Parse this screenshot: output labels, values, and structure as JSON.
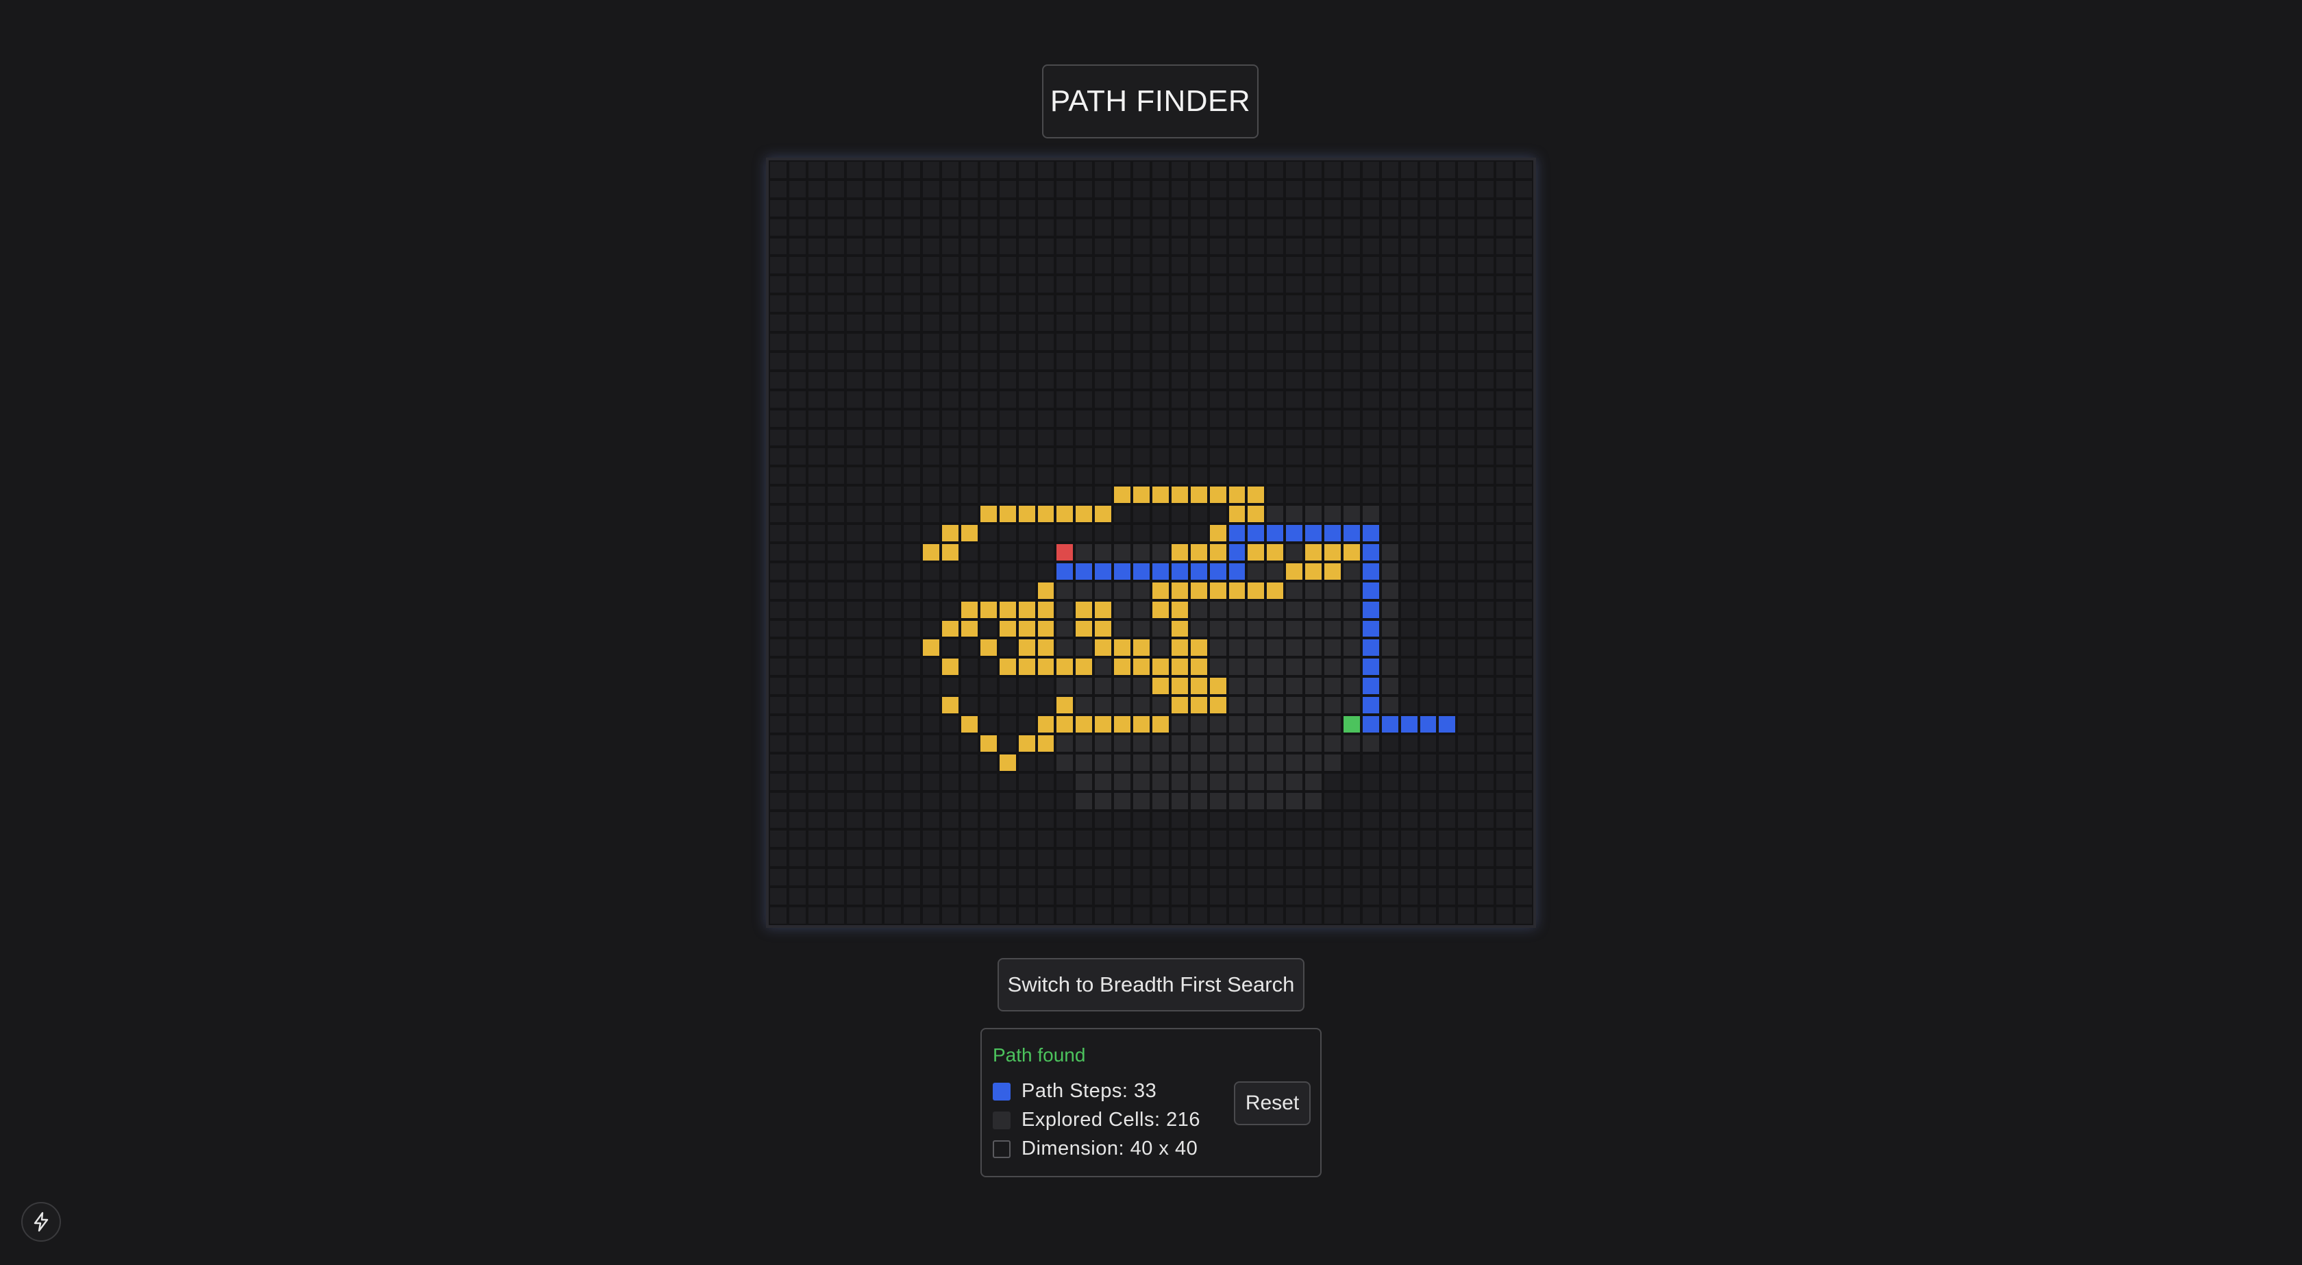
{
  "title": "PATH FINDER",
  "controls": {
    "algorithm_button": "Switch to Breadth First Search",
    "reset_button": "Reset"
  },
  "status": {
    "message": "Path found",
    "path_steps": "Path Steps: 33",
    "explored_cells": "Explored Cells: 216",
    "dimension": "Dimension: 40 x 40"
  },
  "icons": {
    "corner": "lightning-bolt-icon"
  },
  "colors": {
    "wall": "#e8b83a",
    "path": "#3461e6",
    "start": "#df4a4a",
    "end": "#4cc35d",
    "explored": "#2b2b2e",
    "status_ok": "#4cc35d"
  },
  "grid": {
    "rows": 40,
    "cols": 40,
    "start": [
      20,
      15
    ],
    "end": [
      29,
      30
    ],
    "walls": [
      [
        17,
        18
      ],
      [
        17,
        19
      ],
      [
        17,
        20
      ],
      [
        17,
        21
      ],
      [
        17,
        22
      ],
      [
        17,
        23
      ],
      [
        17,
        24
      ],
      [
        17,
        25
      ],
      [
        18,
        11
      ],
      [
        18,
        12
      ],
      [
        18,
        13
      ],
      [
        18,
        14
      ],
      [
        18,
        15
      ],
      [
        18,
        16
      ],
      [
        18,
        17
      ],
      [
        18,
        24
      ],
      [
        18,
        25
      ],
      [
        19,
        9
      ],
      [
        19,
        10
      ],
      [
        19,
        23
      ],
      [
        20,
        8
      ],
      [
        20,
        9
      ],
      [
        20,
        21
      ],
      [
        20,
        22
      ],
      [
        20,
        23
      ],
      [
        20,
        25
      ],
      [
        20,
        26
      ],
      [
        20,
        28
      ],
      [
        20,
        29
      ],
      [
        20,
        30
      ],
      [
        21,
        27
      ],
      [
        21,
        28
      ],
      [
        21,
        29
      ],
      [
        22,
        14
      ],
      [
        22,
        20
      ],
      [
        22,
        21
      ],
      [
        22,
        22
      ],
      [
        22,
        23
      ],
      [
        22,
        24
      ],
      [
        22,
        25
      ],
      [
        22,
        26
      ],
      [
        23,
        10
      ],
      [
        23,
        11
      ],
      [
        23,
        12
      ],
      [
        23,
        13
      ],
      [
        23,
        14
      ],
      [
        23,
        16
      ],
      [
        23,
        17
      ],
      [
        23,
        20
      ],
      [
        23,
        21
      ],
      [
        24,
        9
      ],
      [
        24,
        10
      ],
      [
        24,
        12
      ],
      [
        24,
        13
      ],
      [
        24,
        14
      ],
      [
        24,
        16
      ],
      [
        24,
        17
      ],
      [
        24,
        21
      ],
      [
        25,
        8
      ],
      [
        25,
        11
      ],
      [
        25,
        13
      ],
      [
        25,
        14
      ],
      [
        25,
        17
      ],
      [
        25,
        18
      ],
      [
        25,
        19
      ],
      [
        25,
        21
      ],
      [
        25,
        22
      ],
      [
        26,
        9
      ],
      [
        26,
        12
      ],
      [
        26,
        13
      ],
      [
        26,
        14
      ],
      [
        26,
        15
      ],
      [
        26,
        16
      ],
      [
        26,
        18
      ],
      [
        26,
        19
      ],
      [
        26,
        20
      ],
      [
        26,
        21
      ],
      [
        26,
        22
      ],
      [
        27,
        20
      ],
      [
        27,
        21
      ],
      [
        27,
        22
      ],
      [
        27,
        23
      ],
      [
        28,
        9
      ],
      [
        28,
        15
      ],
      [
        28,
        21
      ],
      [
        28,
        22
      ],
      [
        28,
        23
      ],
      [
        29,
        10
      ],
      [
        29,
        14
      ],
      [
        29,
        15
      ],
      [
        29,
        16
      ],
      [
        29,
        17
      ],
      [
        29,
        18
      ],
      [
        29,
        19
      ],
      [
        29,
        20
      ],
      [
        30,
        11
      ],
      [
        30,
        13
      ],
      [
        30,
        14
      ],
      [
        31,
        12
      ]
    ],
    "path": [
      [
        21,
        15
      ],
      [
        21,
        16
      ],
      [
        21,
        17
      ],
      [
        21,
        18
      ],
      [
        21,
        19
      ],
      [
        21,
        20
      ],
      [
        21,
        21
      ],
      [
        21,
        22
      ],
      [
        21,
        23
      ],
      [
        21,
        24
      ],
      [
        20,
        24
      ],
      [
        19,
        24
      ],
      [
        19,
        25
      ],
      [
        19,
        26
      ],
      [
        19,
        27
      ],
      [
        19,
        28
      ],
      [
        19,
        29
      ],
      [
        19,
        30
      ],
      [
        19,
        31
      ],
      [
        20,
        31
      ],
      [
        21,
        31
      ],
      [
        22,
        31
      ],
      [
        23,
        31
      ],
      [
        24,
        31
      ],
      [
        25,
        31
      ],
      [
        26,
        31
      ],
      [
        27,
        31
      ],
      [
        28,
        31
      ],
      [
        29,
        31
      ],
      [
        29,
        32
      ],
      [
        29,
        33
      ],
      [
        29,
        34
      ],
      [
        29,
        35
      ]
    ],
    "explored_regions": [
      [
        18,
        19,
        26,
        32
      ],
      [
        19,
        20,
        24,
        32
      ],
      [
        20,
        29,
        15,
        33
      ],
      [
        29,
        31,
        14,
        32
      ],
      [
        31,
        32,
        15,
        30
      ],
      [
        32,
        34,
        16,
        29
      ]
    ]
  }
}
